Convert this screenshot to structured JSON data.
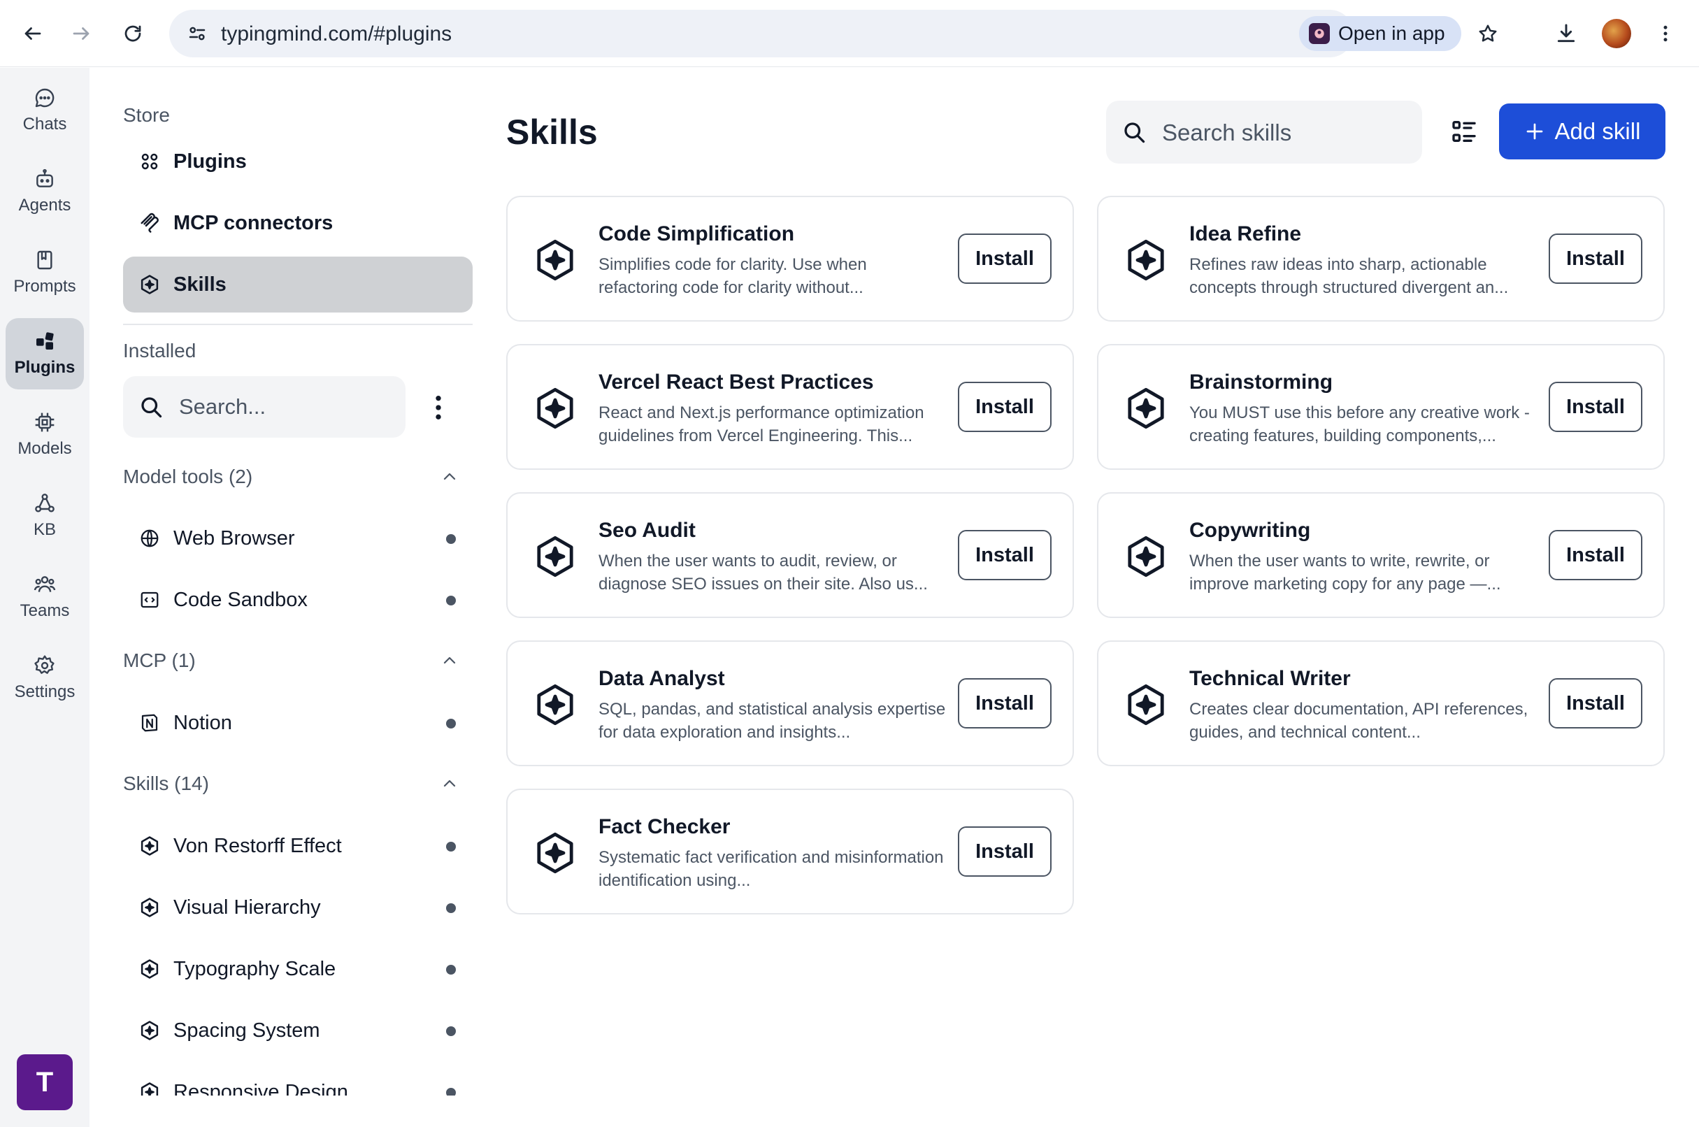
{
  "browser": {
    "url": "typingmind.com/#plugins",
    "open_in_app": "Open in app"
  },
  "rail": {
    "items": [
      {
        "label": "Chats",
        "icon": "chat-bubble-icon"
      },
      {
        "label": "Agents",
        "icon": "agent-icon"
      },
      {
        "label": "Prompts",
        "icon": "bookmark-icon"
      },
      {
        "label": "Plugins",
        "icon": "plugins-icon",
        "active": true
      },
      {
        "label": "Models",
        "icon": "chip-icon"
      },
      {
        "label": "KB",
        "icon": "knowledge-base-icon"
      },
      {
        "label": "Teams",
        "icon": "teams-icon"
      },
      {
        "label": "Settings",
        "icon": "gear-icon"
      }
    ],
    "logo_letter": "T",
    "logo_color": "#5b1a8c"
  },
  "sidebar": {
    "store_title": "Store",
    "store_items": [
      {
        "label": "Plugins",
        "icon": "grid-icon"
      },
      {
        "label": "MCP connectors",
        "icon": "mcp-icon"
      },
      {
        "label": "Skills",
        "icon": "skill-hex-icon",
        "active": true
      }
    ],
    "installed_title": "Installed",
    "search_placeholder": "Search...",
    "groups": [
      {
        "title": "Model tools (2)",
        "items": [
          {
            "label": "Web Browser",
            "icon": "globe-icon"
          },
          {
            "label": "Code Sandbox",
            "icon": "code-box-icon"
          }
        ]
      },
      {
        "title": "MCP (1)",
        "items": [
          {
            "label": "Notion",
            "icon": "notion-icon"
          }
        ]
      },
      {
        "title": "Skills (14)",
        "items": [
          {
            "label": "Von Restorff Effect",
            "icon": "skill-hex-icon"
          },
          {
            "label": "Visual Hierarchy",
            "icon": "skill-hex-icon"
          },
          {
            "label": "Typography Scale",
            "icon": "skill-hex-icon"
          },
          {
            "label": "Spacing System",
            "icon": "skill-hex-icon"
          },
          {
            "label": "Responsive Design",
            "icon": "skill-hex-icon"
          }
        ]
      }
    ]
  },
  "main": {
    "title": "Skills",
    "search_placeholder": "Search skills",
    "add_label": "Add skill",
    "accent_color": "#1d4ed8",
    "install_label": "Install",
    "skills": [
      {
        "name": "Code Simplification",
        "description": "Simplifies code for clarity. Use when refactoring code for clarity without..."
      },
      {
        "name": "Idea Refine",
        "description": "Refines raw ideas into sharp, actionable concepts through structured divergent an..."
      },
      {
        "name": "Vercel React Best Practices",
        "description": "React and Next.js performance optimization guidelines from Vercel Engineering. This..."
      },
      {
        "name": "Brainstorming",
        "description": "You MUST use this before any creative work - creating features, building components,..."
      },
      {
        "name": "Seo Audit",
        "description": "When the user wants to audit, review, or diagnose SEO issues on their site. Also us..."
      },
      {
        "name": "Copywriting",
        "description": "When the user wants to write, rewrite, or improve marketing copy for any page —..."
      },
      {
        "name": "Data Analyst",
        "description": "SQL, pandas, and statistical analysis expertise for data exploration and insights..."
      },
      {
        "name": "Technical Writer",
        "description": "Creates clear documentation, API references, guides, and technical content..."
      },
      {
        "name": "Fact Checker",
        "description": "Systematic fact verification and misinformation identification using..."
      }
    ]
  }
}
